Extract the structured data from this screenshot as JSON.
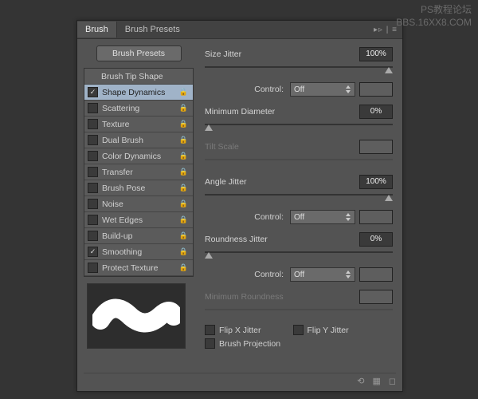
{
  "watermark": {
    "line1": "PS教程论坛",
    "line2": "BBS.16XX8.COM"
  },
  "tabs": {
    "brush": "Brush",
    "presets": "Brush Presets"
  },
  "presets_button": "Brush Presets",
  "options": {
    "tip": "Brush Tip Shape",
    "shape_dynamics": "Shape Dynamics",
    "scattering": "Scattering",
    "texture": "Texture",
    "dual_brush": "Dual Brush",
    "color_dynamics": "Color Dynamics",
    "transfer": "Transfer",
    "brush_pose": "Brush Pose",
    "noise": "Noise",
    "wet_edges": "Wet Edges",
    "build_up": "Build-up",
    "smoothing": "Smoothing",
    "protect_texture": "Protect Texture"
  },
  "controls": {
    "size_jitter": {
      "label": "Size Jitter",
      "value": "100%"
    },
    "control_label": "Control:",
    "control_off": "Off",
    "min_diameter": {
      "label": "Minimum Diameter",
      "value": "0%"
    },
    "tilt_scale": {
      "label": "Tilt Scale"
    },
    "angle_jitter": {
      "label": "Angle Jitter",
      "value": "100%"
    },
    "roundness_jitter": {
      "label": "Roundness Jitter",
      "value": "0%"
    },
    "min_roundness": {
      "label": "Minimum Roundness"
    },
    "flip_x": "Flip X Jitter",
    "flip_y": "Flip Y Jitter",
    "brush_projection": "Brush Projection"
  }
}
